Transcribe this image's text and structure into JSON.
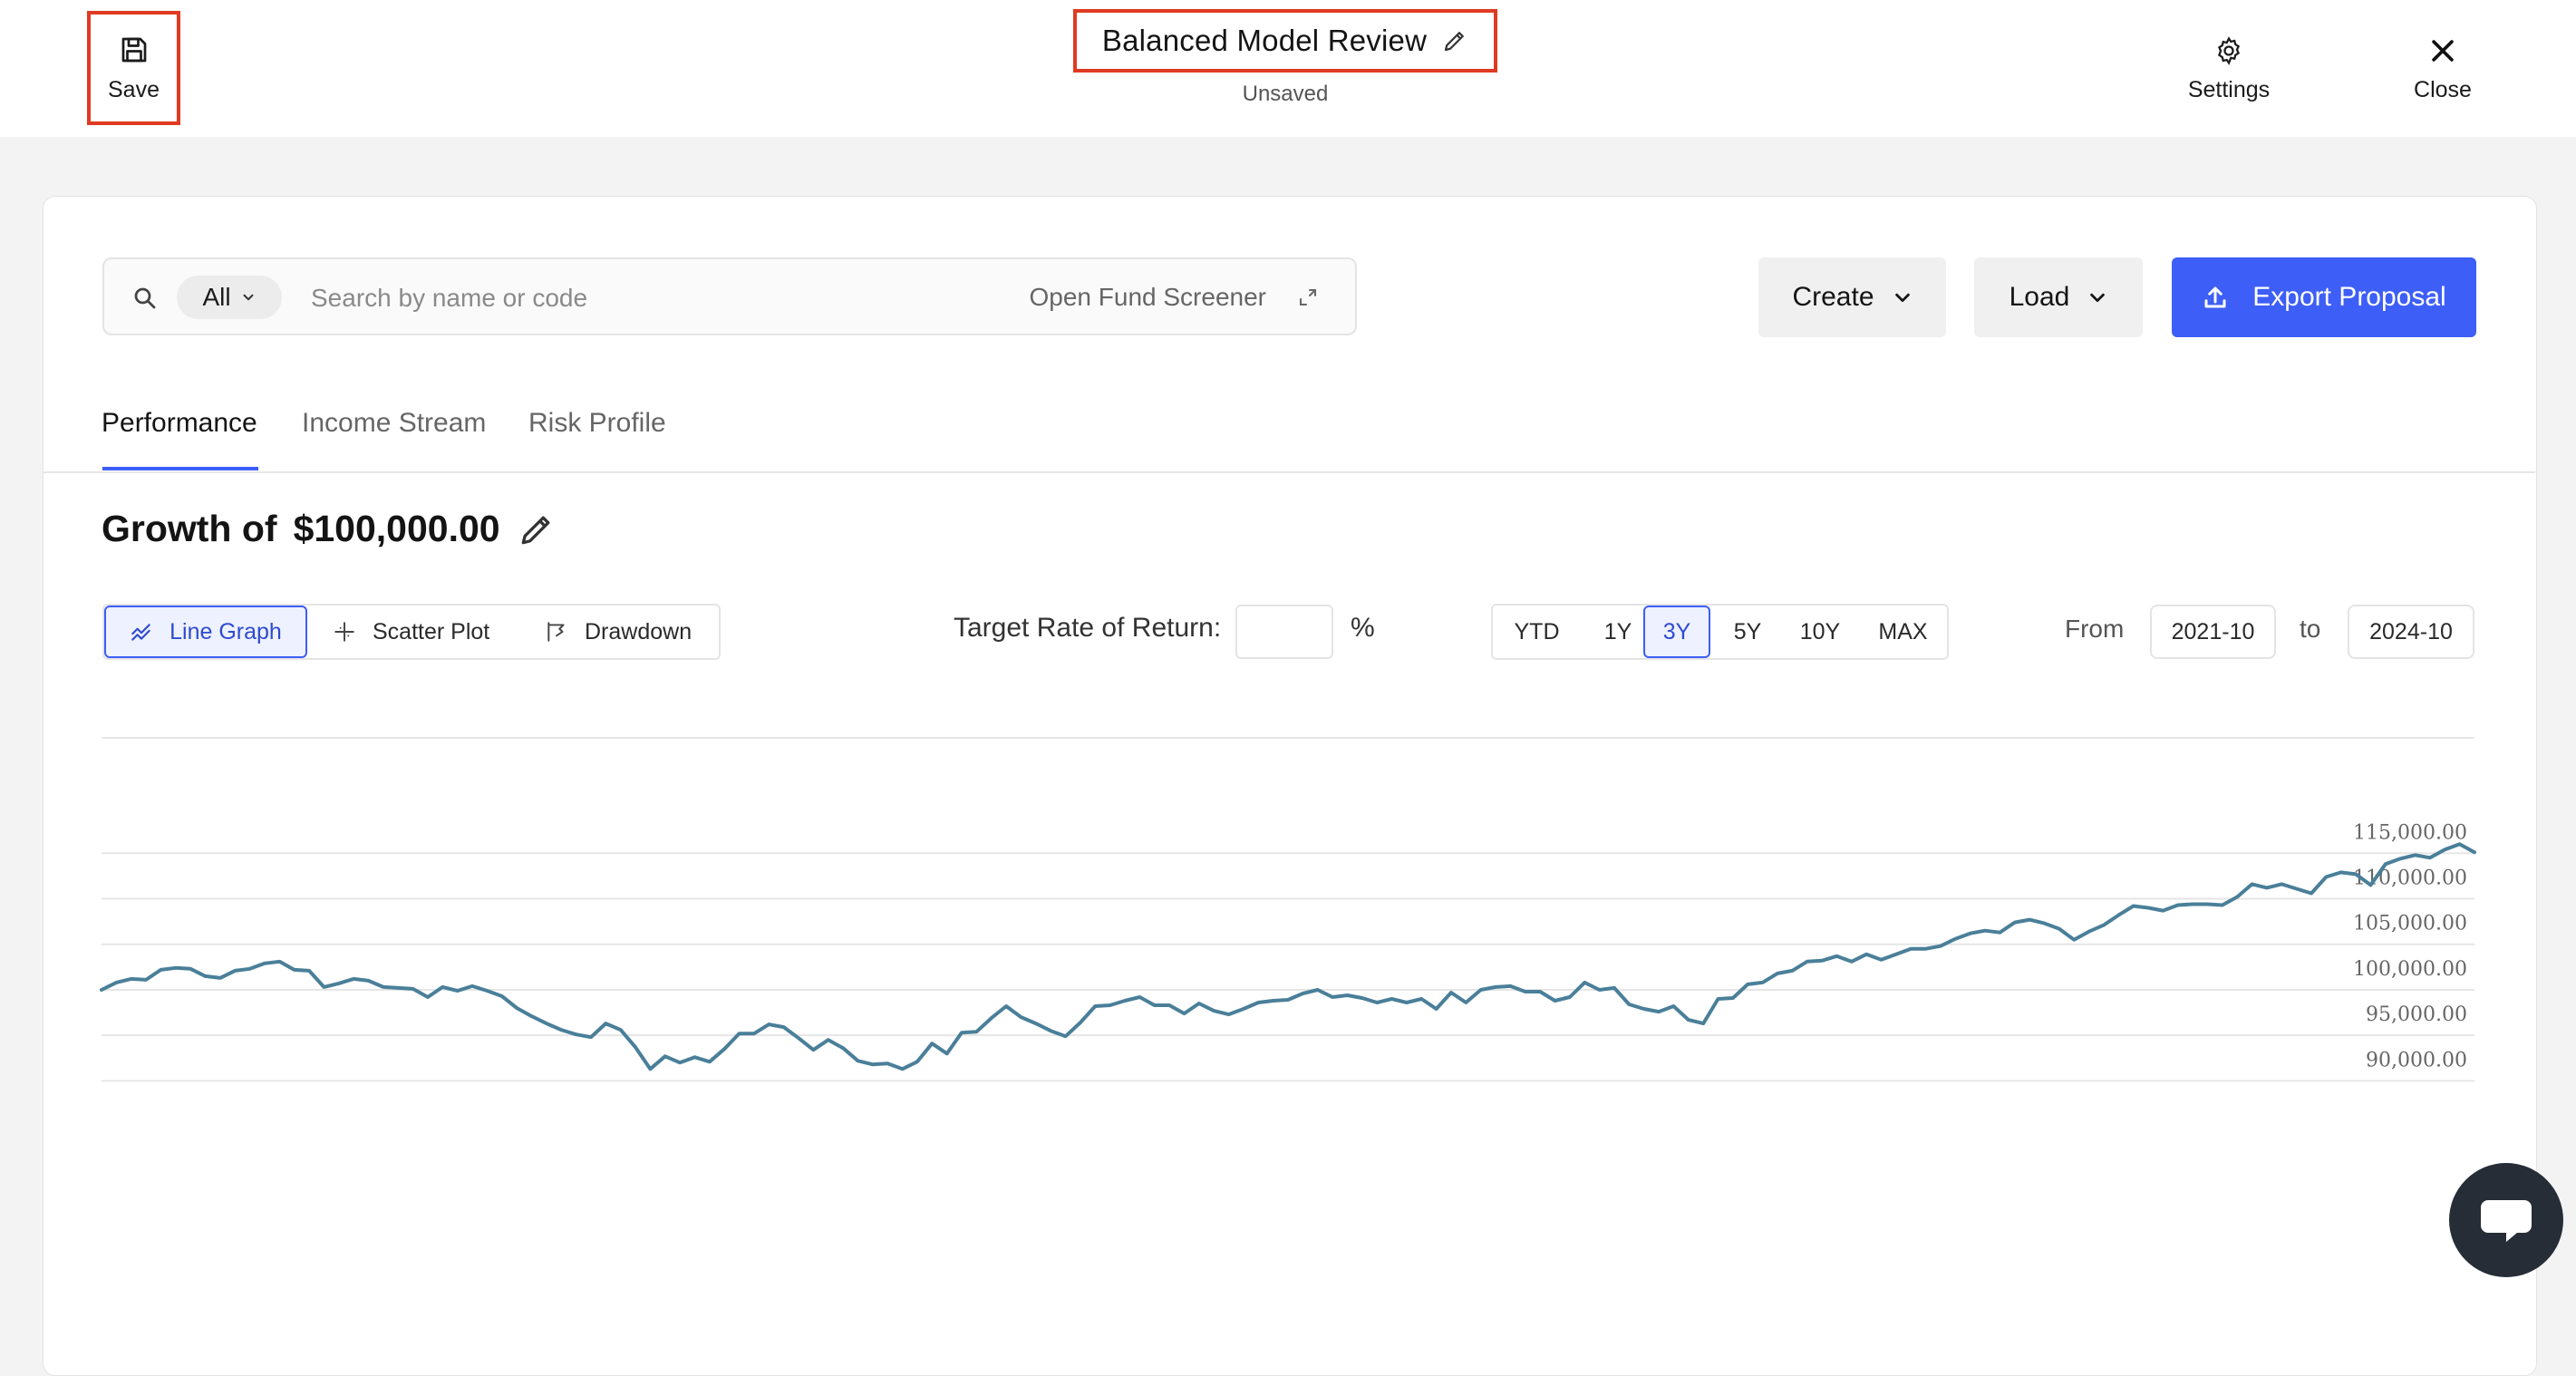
{
  "header": {
    "save_label": "Save",
    "title": "Balanced Model Review",
    "status": "Unsaved",
    "settings_label": "Settings",
    "close_label": "Close"
  },
  "search": {
    "filter_value": "All",
    "placeholder": "Search by name or code",
    "screener_label": "Open Fund Screener"
  },
  "toolbar": {
    "create_label": "Create",
    "load_label": "Load",
    "export_label": "Export Proposal"
  },
  "tabs": [
    {
      "label": "Performance",
      "active": true
    },
    {
      "label": "Income Stream",
      "active": false
    },
    {
      "label": "Risk Profile",
      "active": false
    }
  ],
  "section": {
    "growth_prefix": "Growth of",
    "growth_amount": "$100,000.00"
  },
  "views": [
    {
      "label": "Line Graph",
      "active": true
    },
    {
      "label": "Scatter Plot",
      "active": false
    },
    {
      "label": "Drawdown",
      "active": false
    }
  ],
  "target": {
    "label": "Target Rate of Return:",
    "value": "",
    "unit": "%"
  },
  "periods": [
    {
      "label": "YTD",
      "active": false
    },
    {
      "label": "1Y",
      "active": false
    },
    {
      "label": "3Y",
      "active": true
    },
    {
      "label": "5Y",
      "active": false
    },
    {
      "label": "10Y",
      "active": false
    },
    {
      "label": "MAX",
      "active": false
    }
  ],
  "range": {
    "from_label": "From",
    "from_value": "2021-10",
    "to_label": "to",
    "to_value": "2024-10"
  },
  "colors": {
    "accent": "#3d5ef7",
    "highlight": "#e03a22",
    "series": "#4a7f99"
  },
  "chart_data": {
    "type": "line",
    "title": "",
    "xlabel": "",
    "ylabel": "",
    "x_range": [
      "2021-10",
      "2024-10"
    ],
    "ylim": [
      89000,
      118000
    ],
    "yticks": [
      "115,000.00",
      "110,000.00",
      "105,000.00",
      "100,000.00",
      "95,000.00",
      "90,000.00"
    ],
    "ytick_values": [
      115000,
      110000,
      105000,
      100000,
      95000,
      90000
    ],
    "grid": true,
    "series": [
      {
        "values": [
          100000,
          100800,
          101200,
          101100,
          102200,
          102400,
          102300,
          101500,
          101300,
          102100,
          102300,
          102900,
          103100,
          102200,
          102100,
          100300,
          100700,
          101200,
          101000,
          100300,
          100200,
          100100,
          99200,
          100300,
          99900,
          100400,
          99900,
          99300,
          98000,
          97100,
          96300,
          95600,
          95100,
          94800,
          96300,
          95600,
          93700,
          91300,
          92700,
          92000,
          92600,
          92100,
          93500,
          95200,
          95200,
          96200,
          95900,
          94700,
          93400,
          94500,
          93600,
          92200,
          91800,
          91900,
          91300,
          92100,
          94100,
          93000,
          95300,
          95400,
          96900,
          98200,
          97000,
          96300,
          95500,
          94900,
          96400,
          98200,
          98300,
          98800,
          99200,
          98300,
          98300,
          97400,
          98500,
          97700,
          97300,
          97900,
          98600,
          98800,
          98900,
          99600,
          100000,
          99200,
          99400,
          99100,
          98600,
          99000,
          98600,
          99000,
          97900,
          99700,
          98600,
          100000,
          100300,
          100400,
          99800,
          99800,
          98800,
          99200,
          100800,
          100000,
          100200,
          98400,
          97900,
          97600,
          98200,
          96700,
          96300,
          99000,
          99100,
          100600,
          100800,
          101800,
          102100,
          103100,
          103200,
          103700,
          103100,
          103900,
          103300,
          103900,
          104500,
          104500,
          104800,
          105600,
          106200,
          106500,
          106300,
          107400,
          107700,
          107300,
          106700,
          105500,
          106400,
          107100,
          108200,
          109200,
          109000,
          108700,
          109300,
          109400,
          109400,
          109300,
          110200,
          111600,
          111200,
          111600,
          111100,
          110600,
          112400,
          112900,
          112700,
          111500,
          113800,
          114400,
          114800,
          114500,
          115400,
          116000,
          115100
        ]
      }
    ]
  }
}
